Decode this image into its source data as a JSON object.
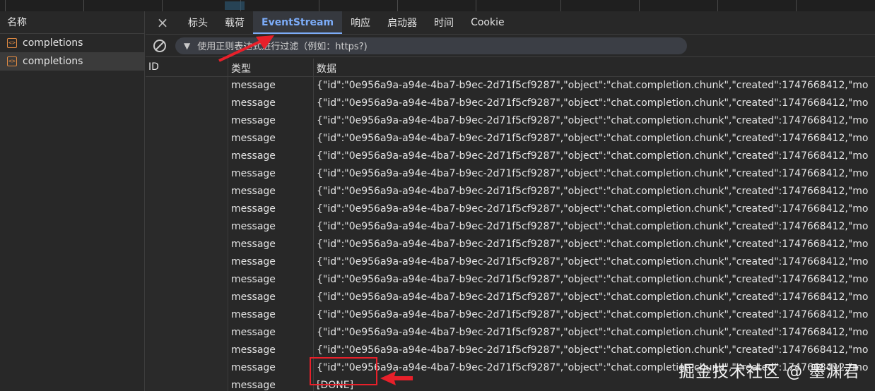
{
  "left_panel": {
    "header": "名称",
    "requests": [
      {
        "name": "completions",
        "selected": false
      },
      {
        "name": "completions",
        "selected": true
      }
    ],
    "icon": "document-icon"
  },
  "tabs": {
    "close": "×",
    "items": [
      "标头",
      "载荷",
      "EventStream",
      "响应",
      "启动器",
      "时间",
      "Cookie"
    ],
    "active": "EventStream"
  },
  "filter": {
    "placeholder": "使用正则表达式进行过滤（例如：https?)"
  },
  "columns": {
    "id": "ID",
    "type": "类型",
    "data": "数据"
  },
  "rows": [
    {
      "type": "message",
      "data": "{\"id\":\"0e956a9a-a94e-4ba7-b9ec-2d71f5cf9287\",\"object\":\"chat.completion.chunk\",\"created\":1747668412,\"mo"
    },
    {
      "type": "message",
      "data": "{\"id\":\"0e956a9a-a94e-4ba7-b9ec-2d71f5cf9287\",\"object\":\"chat.completion.chunk\",\"created\":1747668412,\"mo"
    },
    {
      "type": "message",
      "data": "{\"id\":\"0e956a9a-a94e-4ba7-b9ec-2d71f5cf9287\",\"object\":\"chat.completion.chunk\",\"created\":1747668412,\"mo"
    },
    {
      "type": "message",
      "data": "{\"id\":\"0e956a9a-a94e-4ba7-b9ec-2d71f5cf9287\",\"object\":\"chat.completion.chunk\",\"created\":1747668412,\"mo"
    },
    {
      "type": "message",
      "data": "{\"id\":\"0e956a9a-a94e-4ba7-b9ec-2d71f5cf9287\",\"object\":\"chat.completion.chunk\",\"created\":1747668412,\"mo"
    },
    {
      "type": "message",
      "data": "{\"id\":\"0e956a9a-a94e-4ba7-b9ec-2d71f5cf9287\",\"object\":\"chat.completion.chunk\",\"created\":1747668412,\"mo"
    },
    {
      "type": "message",
      "data": "{\"id\":\"0e956a9a-a94e-4ba7-b9ec-2d71f5cf9287\",\"object\":\"chat.completion.chunk\",\"created\":1747668412,\"mo"
    },
    {
      "type": "message",
      "data": "{\"id\":\"0e956a9a-a94e-4ba7-b9ec-2d71f5cf9287\",\"object\":\"chat.completion.chunk\",\"created\":1747668412,\"mo"
    },
    {
      "type": "message",
      "data": "{\"id\":\"0e956a9a-a94e-4ba7-b9ec-2d71f5cf9287\",\"object\":\"chat.completion.chunk\",\"created\":1747668412,\"mo"
    },
    {
      "type": "message",
      "data": "{\"id\":\"0e956a9a-a94e-4ba7-b9ec-2d71f5cf9287\",\"object\":\"chat.completion.chunk\",\"created\":1747668412,\"mo"
    },
    {
      "type": "message",
      "data": "{\"id\":\"0e956a9a-a94e-4ba7-b9ec-2d71f5cf9287\",\"object\":\"chat.completion.chunk\",\"created\":1747668412,\"mo"
    },
    {
      "type": "message",
      "data": "{\"id\":\"0e956a9a-a94e-4ba7-b9ec-2d71f5cf9287\",\"object\":\"chat.completion.chunk\",\"created\":1747668412,\"mo"
    },
    {
      "type": "message",
      "data": "{\"id\":\"0e956a9a-a94e-4ba7-b9ec-2d71f5cf9287\",\"object\":\"chat.completion.chunk\",\"created\":1747668412,\"mo"
    },
    {
      "type": "message",
      "data": "{\"id\":\"0e956a9a-a94e-4ba7-b9ec-2d71f5cf9287\",\"object\":\"chat.completion.chunk\",\"created\":1747668412,\"mo"
    },
    {
      "type": "message",
      "data": "{\"id\":\"0e956a9a-a94e-4ba7-b9ec-2d71f5cf9287\",\"object\":\"chat.completion.chunk\",\"created\":1747668412,\"mo"
    },
    {
      "type": "message",
      "data": "{\"id\":\"0e956a9a-a94e-4ba7-b9ec-2d71f5cf9287\",\"object\":\"chat.completion.chunk\",\"created\":1747668412,\"mo"
    },
    {
      "type": "message",
      "data": "{\"id\":\"0e956a9a-a94e-4ba7-b9ec-2d71f5cf9287\",\"object\":\"chat.completion.chunk\",\"created\":1747668412,\"mo"
    },
    {
      "type": "message",
      "data": "[DONE]"
    }
  ],
  "watermark": "掘金技术社区 @ 墨渊君",
  "colors": {
    "background": "#282828",
    "active_tab": "#7cacf8",
    "annotation": "#e8202a"
  }
}
